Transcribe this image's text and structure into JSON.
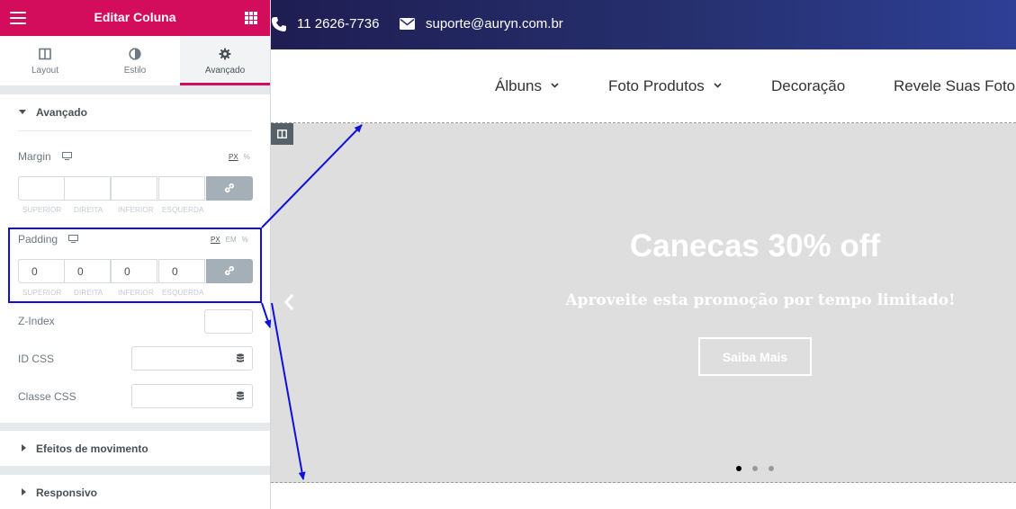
{
  "panel": {
    "header_title": "Editar Coluna",
    "tabs": [
      {
        "label": "Layout",
        "icon": "columns-icon"
      },
      {
        "label": "Estilo",
        "icon": "contrast-icon"
      },
      {
        "label": "Avançado",
        "icon": "gear-icon",
        "active": true
      }
    ],
    "section_avancado": "Avançado",
    "margin": {
      "label": "Margin",
      "units": [
        "PX",
        "%"
      ],
      "active_unit": "PX",
      "values": [
        "",
        "",
        "",
        ""
      ],
      "labels": [
        "SUPERIOR",
        "DIREITA",
        "INFERIOR",
        "ESQUERDA"
      ]
    },
    "padding": {
      "label": "Padding",
      "units": [
        "PX",
        "EM",
        "%"
      ],
      "active_unit": "PX",
      "values": [
        "0",
        "0",
        "0",
        "0"
      ],
      "labels": [
        "SUPERIOR",
        "DIREITA",
        "INFERIOR",
        "ESQUERDA"
      ]
    },
    "zindex_label": "Z-Index",
    "idcss_label": "ID CSS",
    "classcss_label": "Classe CSS",
    "section_efeitos": "Efeitos de movimento",
    "section_responsivo": "Responsivo"
  },
  "site": {
    "phone": "11 2626-7736",
    "email": "suporte@auryn.com.br",
    "nav": [
      "Álbuns",
      "Foto Produtos",
      "Decoração",
      "Revele Suas Fotos"
    ],
    "slide": {
      "title": "Canecas 30% off",
      "subtitle": "Aproveite esta promoção por tempo limitado!",
      "button": "Saiba Mais"
    }
  },
  "colors": {
    "brand": "#d30c5c",
    "topbar_start": "#1f1d52",
    "topbar_end": "#2e3f95",
    "annotation": "#1010d8"
  }
}
